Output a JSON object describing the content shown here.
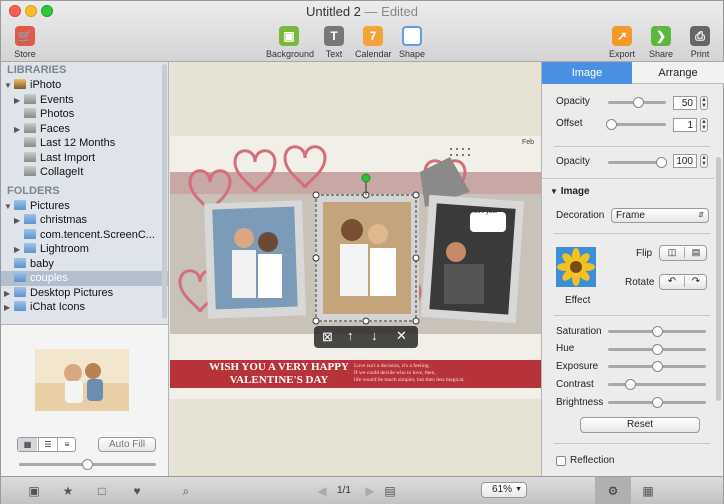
{
  "window": {
    "title": "Untitled 2",
    "title_suffix": "— Edited"
  },
  "toolbar": {
    "store": "Store",
    "background": "Background",
    "text": "Text",
    "calendar": "Calendar",
    "shape": "Shape",
    "export": "Export",
    "share": "Share",
    "print": "Print"
  },
  "sidebar": {
    "libraries_head": "LIBRARIES",
    "libraries": [
      {
        "label": "iPhoto",
        "expanded": true
      },
      {
        "label": "Events"
      },
      {
        "label": "Photos"
      },
      {
        "label": "Faces"
      },
      {
        "label": "Last 12 Months"
      },
      {
        "label": "Last Import"
      },
      {
        "label": "CollageIt"
      }
    ],
    "folders_head": "FOLDERS",
    "folders": [
      {
        "label": "Pictures"
      },
      {
        "label": "christmas"
      },
      {
        "label": "com.tencent.ScreenC..."
      },
      {
        "label": "Lightroom"
      },
      {
        "label": "baby"
      },
      {
        "label": "couples",
        "selected": true
      },
      {
        "label": "Desktop Pictures"
      },
      {
        "label": "iChat Icons"
      }
    ]
  },
  "preview": {
    "auto_fill": "Auto Fill"
  },
  "canvas": {
    "month": "Feb",
    "banner_line1": "WISH YOU A VERY HAPPY",
    "banner_line2": "VALENTINE'S DAY",
    "banner_small1": "Love isn't a decision, it's a feeling.",
    "banner_small2": "If we could decide who to love, then,",
    "banner_small3": "life would be much simpler, but then less magical.",
    "speech": "I love you!"
  },
  "inspector": {
    "tab_image": "Image",
    "tab_arrange": "Arrange",
    "opacity_label": "Opacity",
    "opacity_value": "50",
    "offset_label": "Offset",
    "offset_value": "1",
    "opacity2_label": "Opacity",
    "opacity2_value": "100",
    "image_head": "Image",
    "decoration_label": "Decoration",
    "decoration_value": "Frame",
    "flip_label": "Flip",
    "rotate_label": "Rotate",
    "effect_label": "Effect",
    "saturation": "Saturation",
    "hue": "Hue",
    "exposure": "Exposure",
    "contrast": "Contrast",
    "brightness": "Brightness",
    "reset": "Reset",
    "reflection": "Reflection"
  },
  "bottombar": {
    "page": "1/1",
    "zoom": "61%"
  },
  "colors": {
    "accent_blue": "#4a90e2",
    "selection": "#b3bfcf",
    "banner_red": "#b8323a"
  }
}
